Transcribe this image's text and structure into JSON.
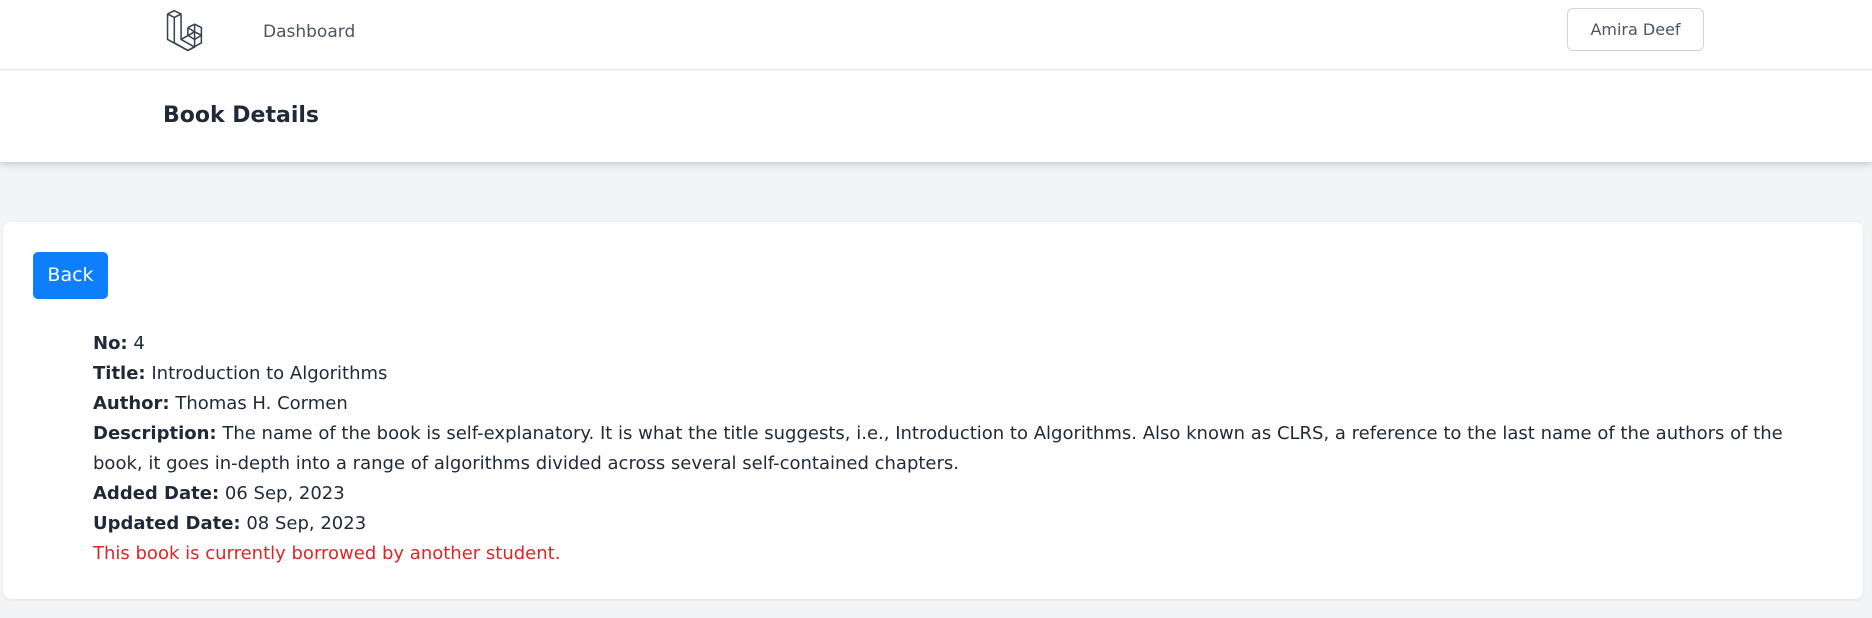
{
  "nav": {
    "dashboard_label": "Dashboard",
    "user_name": "Amira Deef"
  },
  "header": {
    "title": "Book Details"
  },
  "card": {
    "back_label": "Back",
    "fields": {
      "no_label": "No:",
      "no_value": "4",
      "title_label": "Title:",
      "title_value": "Introduction to Algorithms",
      "author_label": "Author:",
      "author_value": "Thomas H. Cormen",
      "description_label": "Description:",
      "description_value": "The name of the book is self-explanatory. It is what the title suggests, i.e., Introduction to Algorithms. Also known as CLRS, a reference to the last name of the authors of the book, it goes in-depth into a range of algorithms divided across several self-contained chapters.",
      "added_label": "Added Date:",
      "added_value": "06 Sep, 2023",
      "updated_label": "Updated Date:",
      "updated_value": "08 Sep, 2023"
    },
    "status_message": "This book is currently borrowed by another student."
  },
  "colors": {
    "primary_button": "#0d7ffd",
    "status_text": "#dc2626",
    "page_background": "#f3f4f6"
  },
  "icons": {
    "logo": "laravel-logo-icon"
  }
}
